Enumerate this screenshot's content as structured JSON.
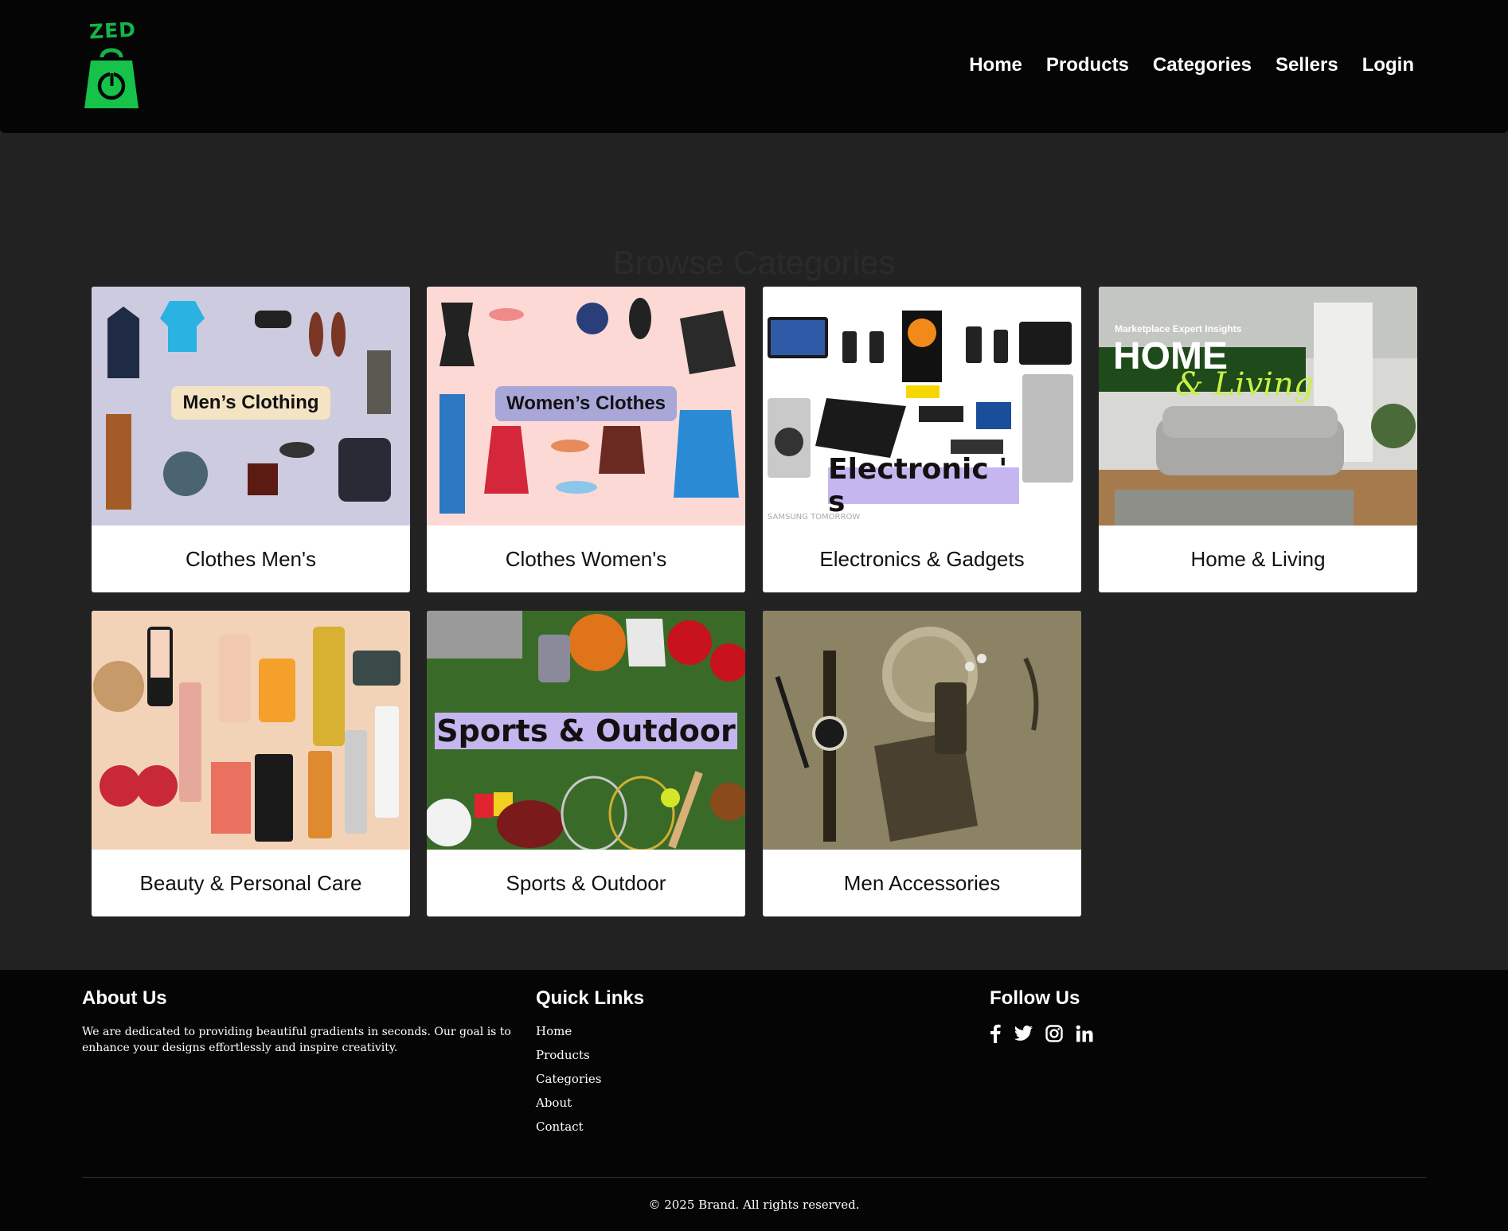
{
  "header": {
    "logo_text": "ZED",
    "nav": [
      "Home",
      "Products",
      "Categories",
      "Sellers",
      "Login"
    ]
  },
  "main": {
    "section_title": "Browse Categories",
    "categories": [
      {
        "label": "Clothes Men's",
        "image_caption": "Men’s Clothing"
      },
      {
        "label": "Clothes Women's",
        "image_caption": "Women’s Clothes"
      },
      {
        "label": "Electronics & Gadgets",
        "image_caption": "Electronic ' s"
      },
      {
        "label": "Home & Living",
        "image_caption": "HOME",
        "image_caption2": "& Living",
        "image_kicker": "Marketplace Expert Insights"
      },
      {
        "label": "Beauty & Personal Care"
      },
      {
        "label": "Sports & Outdoor",
        "image_caption": "Sports & Outdoor"
      },
      {
        "label": "Men Accessories"
      }
    ]
  },
  "footer": {
    "about": {
      "title": "About Us",
      "text": "We are dedicated to providing beautiful gradients in seconds. Our goal is to enhance your designs effortlessly and inspire creativity."
    },
    "links": {
      "title": "Quick Links",
      "items": [
        "Home",
        "Products",
        "Categories",
        "About",
        "Contact"
      ]
    },
    "follow": {
      "title": "Follow Us",
      "icons": [
        "facebook-icon",
        "twitter-icon",
        "instagram-icon",
        "linkedin-icon"
      ]
    },
    "copyright": "© 2025 Brand. All rights reserved."
  },
  "colors": {
    "header_bg": "#050505",
    "page_bg": "#222222",
    "logo_green": "#16b34a",
    "card_bg": "#ffffff"
  }
}
